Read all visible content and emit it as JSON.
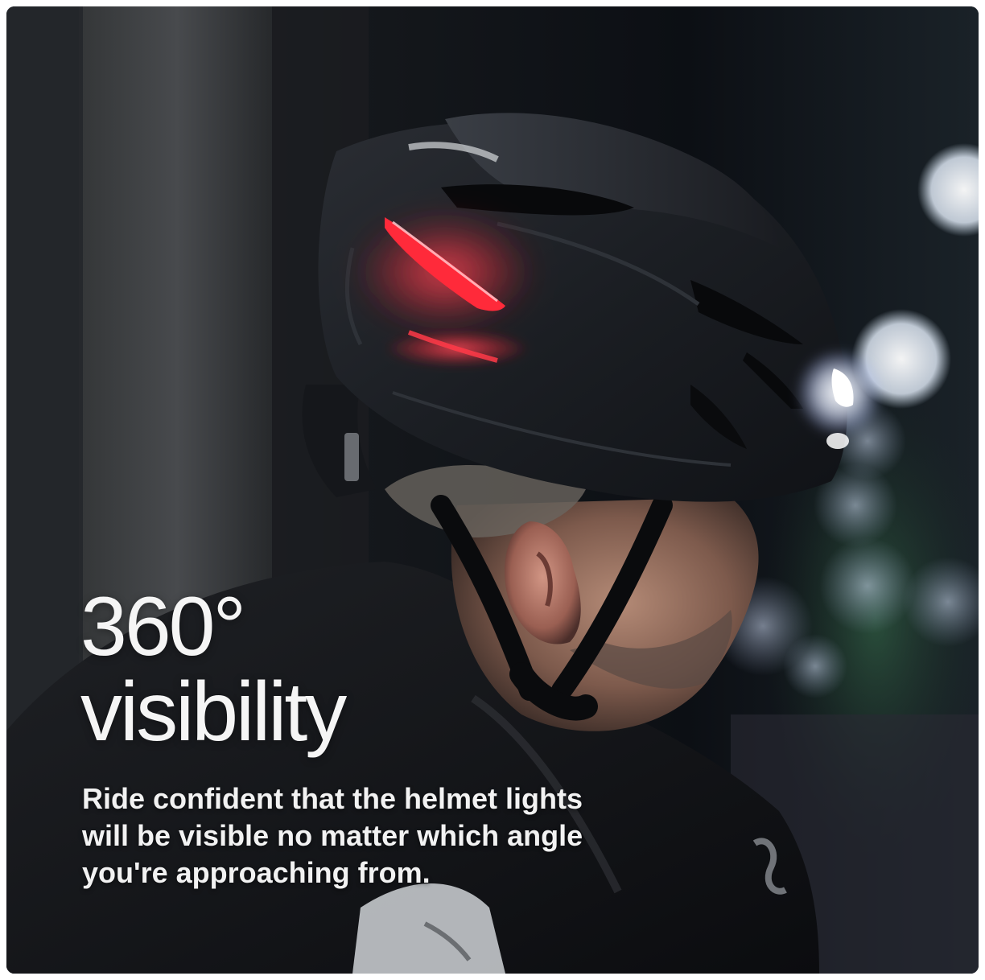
{
  "headline": {
    "line1": "360°",
    "line2": "visibility"
  },
  "body": {
    "line1": "Ride confident that the helmet lights",
    "line2": "will be visible no matter which angle",
    "line3": "you're approaching from."
  },
  "colors": {
    "background": "#0e1116",
    "helmet": "#1d2026",
    "tail_light": "#ff2a3a",
    "front_light": "#dfe8ff",
    "text": "#f5f5f5"
  }
}
